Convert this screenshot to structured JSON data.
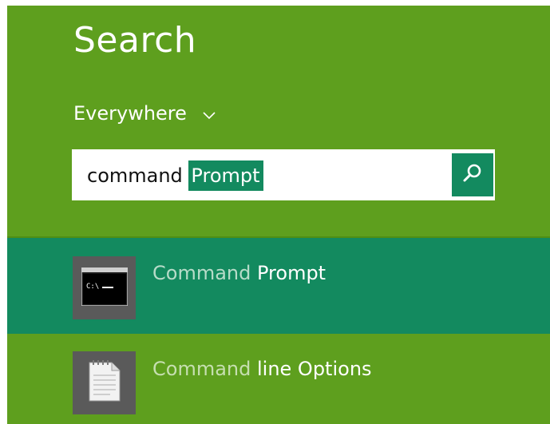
{
  "search_pane": {
    "title": "Search",
    "scope_label": "Everywhere",
    "query": {
      "typed_text": "command ",
      "autocomplete_text": "Prompt"
    }
  },
  "results": [
    {
      "match_text": "Command",
      "rest_text": " Prompt",
      "icon": "command-prompt-icon",
      "selected": true
    },
    {
      "match_text": "Command",
      "rest_text": " line Options",
      "icon": "text-document-icon",
      "selected": false
    }
  ],
  "colors": {
    "pane_background": "#5e9f1e",
    "accent": "#138a5f",
    "tile_background": "#5a5a5a"
  }
}
